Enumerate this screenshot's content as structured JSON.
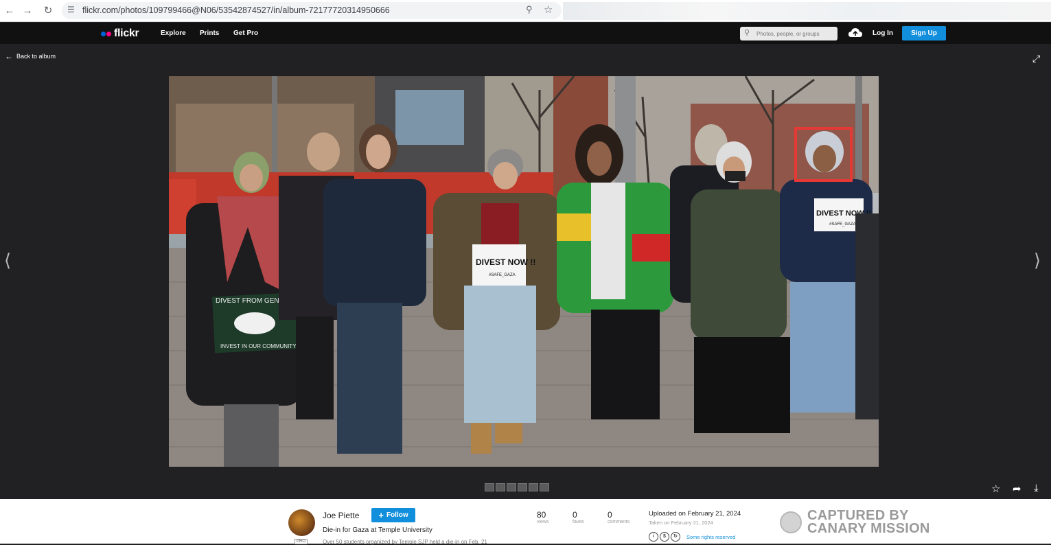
{
  "browser": {
    "url": "flickr.com/photos/109799466@N06/53542874527/in/album-72177720314950666"
  },
  "header": {
    "logo": "flickr",
    "nav": [
      "Explore",
      "Prints",
      "Get Pro"
    ],
    "search_placeholder": "Photos, people, or groups",
    "login_label": "Log In",
    "signup_label": "Sign Up"
  },
  "viewer": {
    "back_label": "Back to album",
    "thumb_count": 6,
    "photo_signs": {
      "sign1": "DIVEST NOW !!",
      "sign1_sub": "#SAFE_GAZA",
      "sign2": "DIVEST NOW !!",
      "sign2_sub": "#SAFE_GAZA",
      "banner_top": "DIVEST FROM GENOCIDE",
      "banner_bottom": "INVEST IN OUR COMMUNITY"
    }
  },
  "info": {
    "owner_name": "Joe Piette",
    "follow_label": "Follow",
    "pro_badge": "PRO",
    "title": "Die-in for Gaza at Temple University",
    "description": "Over 50 students organized by Temple SJP held a die-in on Feb. 21",
    "stats": [
      {
        "num": "80",
        "label": "views"
      },
      {
        "num": "0",
        "label": "faves"
      },
      {
        "num": "0",
        "label": "comments"
      }
    ],
    "uploaded": "Uploaded on February 21, 2024",
    "taken": "Taken on February 21, 2024",
    "rights": "Some rights reserved"
  },
  "watermark": {
    "line1": "CAPTURED BY",
    "line2": "CANARY MISSION"
  },
  "colors": {
    "accent": "#128fdc",
    "header_bg": "#111111",
    "viewer_bg": "#212124",
    "highlight_box": "#e53935"
  }
}
